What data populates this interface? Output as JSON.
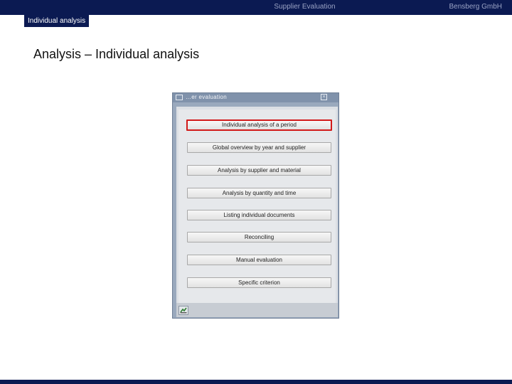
{
  "header": {
    "center_title": "Supplier Evaluation",
    "right_title": "Bensberg GmbH"
  },
  "subheader": {
    "tab_label": "Individual analysis"
  },
  "page": {
    "title": "Analysis – Individual analysis"
  },
  "dialog": {
    "title": "…er evaluation",
    "icons": {
      "window": "window-icon",
      "close": "close-icon",
      "execute": "execute-icon"
    },
    "buttons": [
      {
        "label": "Individual analysis of a period",
        "selected": true
      },
      {
        "label": "Global overview by year and supplier",
        "selected": false
      },
      {
        "label": "Analysis by supplier and material",
        "selected": false
      },
      {
        "label": "Analysis by quantity and time",
        "selected": false
      },
      {
        "label": "Listing individual documents",
        "selected": false
      },
      {
        "label": "Reconciling",
        "selected": false
      },
      {
        "label": "Manual evaluation",
        "selected": false
      },
      {
        "label": "Specific criterion",
        "selected": false
      }
    ]
  },
  "colors": {
    "brand_navy": "#0b1a52",
    "selection_red": "#d21a1a"
  }
}
